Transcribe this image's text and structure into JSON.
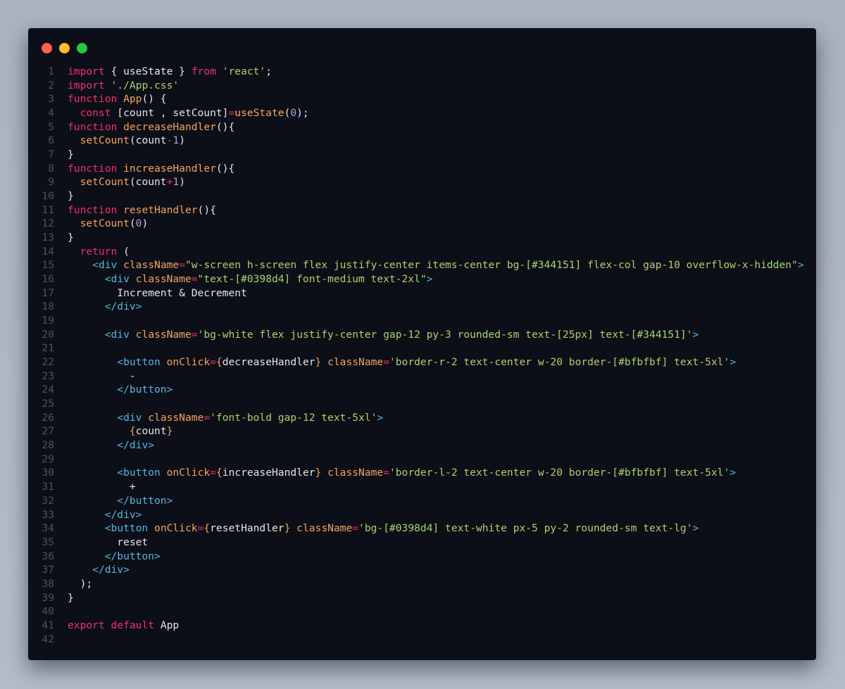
{
  "window": {
    "background": "#0c0f17",
    "traffic_lights": [
      {
        "name": "close",
        "color": "#ff5f57"
      },
      {
        "name": "minimize",
        "color": "#febc2e"
      },
      {
        "name": "maximize",
        "color": "#28c840"
      }
    ]
  },
  "colors": {
    "keyword": "#f0306c",
    "function": "#f5a35f",
    "string": "#a8d46f",
    "tag": "#56b6e0",
    "attr": "#f5a35f",
    "number": "#bd93f9",
    "plain": "#e6e6e6",
    "line_number": "#4b5263"
  },
  "code": {
    "lines": [
      {
        "n": "1",
        "tokens": [
          [
            "kw",
            "import"
          ],
          [
            "p",
            " { useState } "
          ],
          [
            "kw",
            "from"
          ],
          [
            "p",
            " "
          ],
          [
            "str",
            "'react'"
          ],
          [
            "p",
            ";"
          ]
        ]
      },
      {
        "n": "2",
        "tokens": [
          [
            "kw",
            "import"
          ],
          [
            "p",
            " "
          ],
          [
            "str",
            "'./App.css'"
          ]
        ]
      },
      {
        "n": "3",
        "tokens": [
          [
            "kw",
            "function"
          ],
          [
            "p",
            " "
          ],
          [
            "fn",
            "App"
          ],
          [
            "p",
            "() {"
          ]
        ]
      },
      {
        "n": "4",
        "tokens": [
          [
            "p",
            "  "
          ],
          [
            "kw",
            "const"
          ],
          [
            "p",
            " [count , setCount]"
          ],
          [
            "kw",
            "="
          ],
          [
            "fn",
            "useState"
          ],
          [
            "p",
            "("
          ],
          [
            "num",
            "0"
          ],
          [
            "p",
            ");"
          ]
        ]
      },
      {
        "n": "5",
        "tokens": [
          [
            "kw",
            "function"
          ],
          [
            "p",
            " "
          ],
          [
            "fn",
            "decreaseHandler"
          ],
          [
            "p",
            "(){"
          ]
        ]
      },
      {
        "n": "6",
        "tokens": [
          [
            "p",
            "  "
          ],
          [
            "fn",
            "setCount"
          ],
          [
            "p",
            "(count"
          ],
          [
            "kw",
            "-"
          ],
          [
            "num",
            "1"
          ],
          [
            "p",
            ")"
          ]
        ]
      },
      {
        "n": "7",
        "tokens": [
          [
            "p",
            "}"
          ]
        ]
      },
      {
        "n": "8",
        "tokens": [
          [
            "kw",
            "function"
          ],
          [
            "p",
            " "
          ],
          [
            "fn",
            "increaseHandler"
          ],
          [
            "p",
            "(){"
          ]
        ]
      },
      {
        "n": "9",
        "tokens": [
          [
            "p",
            "  "
          ],
          [
            "fn",
            "setCount"
          ],
          [
            "p",
            "(count"
          ],
          [
            "kw",
            "+"
          ],
          [
            "num",
            "1"
          ],
          [
            "p",
            ")"
          ]
        ]
      },
      {
        "n": "10",
        "tokens": [
          [
            "p",
            "}"
          ]
        ]
      },
      {
        "n": "11",
        "tokens": [
          [
            "kw",
            "function"
          ],
          [
            "p",
            " "
          ],
          [
            "fn",
            "resetHandler"
          ],
          [
            "p",
            "(){"
          ]
        ]
      },
      {
        "n": "12",
        "tokens": [
          [
            "p",
            "  "
          ],
          [
            "fn",
            "setCount"
          ],
          [
            "p",
            "("
          ],
          [
            "num",
            "0"
          ],
          [
            "p",
            ")"
          ]
        ]
      },
      {
        "n": "13",
        "tokens": [
          [
            "p",
            "}"
          ]
        ]
      },
      {
        "n": "14",
        "tokens": [
          [
            "p",
            "  "
          ],
          [
            "kw",
            "return"
          ],
          [
            "p",
            " ("
          ]
        ]
      },
      {
        "n": "15",
        "tokens": [
          [
            "p",
            "    "
          ],
          [
            "tag",
            "<div"
          ],
          [
            "p",
            " "
          ],
          [
            "attr",
            "className"
          ],
          [
            "kw",
            "="
          ],
          [
            "str",
            "\"w-screen h-screen flex justify-center items-center bg-[#344151] flex-col gap-10 overflow-x-hidden\""
          ],
          [
            "tag",
            ">"
          ]
        ]
      },
      {
        "n": "16",
        "tokens": [
          [
            "p",
            "      "
          ],
          [
            "tag",
            "<div"
          ],
          [
            "p",
            " "
          ],
          [
            "attr",
            "className"
          ],
          [
            "kw",
            "="
          ],
          [
            "str",
            "\"text-[#0398d4] font-medium text-2xl\""
          ],
          [
            "tag",
            ">"
          ]
        ]
      },
      {
        "n": "17",
        "tokens": [
          [
            "p",
            "        Increment & Decrement"
          ]
        ]
      },
      {
        "n": "18",
        "tokens": [
          [
            "p",
            "      "
          ],
          [
            "tag",
            "</div>"
          ]
        ]
      },
      {
        "n": "19",
        "tokens": []
      },
      {
        "n": "20",
        "tokens": [
          [
            "p",
            "      "
          ],
          [
            "tag",
            "<div"
          ],
          [
            "p",
            " "
          ],
          [
            "attr",
            "className"
          ],
          [
            "kw",
            "="
          ],
          [
            "str",
            "'bg-white flex justify-center gap-12 py-3 rounded-sm text-[25px] text-[#344151]'"
          ],
          [
            "tag",
            ">"
          ]
        ]
      },
      {
        "n": "21",
        "tokens": []
      },
      {
        "n": "22",
        "tokens": [
          [
            "p",
            "        "
          ],
          [
            "tag",
            "<button"
          ],
          [
            "p",
            " "
          ],
          [
            "attr",
            "onClick"
          ],
          [
            "kw",
            "="
          ],
          [
            "fn",
            "{"
          ],
          [
            "p",
            "decreaseHandler"
          ],
          [
            "fn",
            "}"
          ],
          [
            "p",
            " "
          ],
          [
            "attr",
            "className"
          ],
          [
            "kw",
            "="
          ],
          [
            "str",
            "'border-r-2 text-center w-20 border-[#bfbfbf] text-5xl'"
          ],
          [
            "tag",
            ">"
          ]
        ]
      },
      {
        "n": "23",
        "tokens": [
          [
            "p",
            "          -"
          ]
        ]
      },
      {
        "n": "24",
        "tokens": [
          [
            "p",
            "        "
          ],
          [
            "tag",
            "</button>"
          ]
        ]
      },
      {
        "n": "25",
        "tokens": []
      },
      {
        "n": "26",
        "tokens": [
          [
            "p",
            "        "
          ],
          [
            "tag",
            "<div"
          ],
          [
            "p",
            " "
          ],
          [
            "attr",
            "className"
          ],
          [
            "kw",
            "="
          ],
          [
            "str",
            "'font-bold gap-12 text-5xl'"
          ],
          [
            "tag",
            ">"
          ]
        ]
      },
      {
        "n": "27",
        "tokens": [
          [
            "p",
            "          "
          ],
          [
            "fn",
            "{"
          ],
          [
            "p",
            "count"
          ],
          [
            "fn",
            "}"
          ]
        ]
      },
      {
        "n": "28",
        "tokens": [
          [
            "p",
            "        "
          ],
          [
            "tag",
            "</div>"
          ]
        ]
      },
      {
        "n": "29",
        "tokens": []
      },
      {
        "n": "30",
        "tokens": [
          [
            "p",
            "        "
          ],
          [
            "tag",
            "<button"
          ],
          [
            "p",
            " "
          ],
          [
            "attr",
            "onClick"
          ],
          [
            "kw",
            "="
          ],
          [
            "fn",
            "{"
          ],
          [
            "p",
            "increaseHandler"
          ],
          [
            "fn",
            "}"
          ],
          [
            "p",
            " "
          ],
          [
            "attr",
            "className"
          ],
          [
            "kw",
            "="
          ],
          [
            "str",
            "'border-l-2 text-center w-20 border-[#bfbfbf] text-5xl'"
          ],
          [
            "tag",
            ">"
          ]
        ]
      },
      {
        "n": "31",
        "tokens": [
          [
            "p",
            "          +"
          ]
        ]
      },
      {
        "n": "32",
        "tokens": [
          [
            "p",
            "        "
          ],
          [
            "tag",
            "</button>"
          ]
        ]
      },
      {
        "n": "33",
        "tokens": [
          [
            "p",
            "      "
          ],
          [
            "tag",
            "</div>"
          ]
        ]
      },
      {
        "n": "34",
        "tokens": [
          [
            "p",
            "      "
          ],
          [
            "tag",
            "<button"
          ],
          [
            "p",
            " "
          ],
          [
            "attr",
            "onClick"
          ],
          [
            "kw",
            "="
          ],
          [
            "fn",
            "{"
          ],
          [
            "p",
            "resetHandler"
          ],
          [
            "fn",
            "}"
          ],
          [
            "p",
            " "
          ],
          [
            "attr",
            "className"
          ],
          [
            "kw",
            "="
          ],
          [
            "str",
            "'bg-[#0398d4] text-white px-5 py-2 rounded-sm text-lg'"
          ],
          [
            "tag",
            ">"
          ]
        ]
      },
      {
        "n": "35",
        "tokens": [
          [
            "p",
            "        reset"
          ]
        ]
      },
      {
        "n": "36",
        "tokens": [
          [
            "p",
            "      "
          ],
          [
            "tag",
            "</button>"
          ]
        ]
      },
      {
        "n": "37",
        "tokens": [
          [
            "p",
            "    "
          ],
          [
            "tag",
            "</div>"
          ]
        ]
      },
      {
        "n": "38",
        "tokens": [
          [
            "p",
            "  );"
          ]
        ]
      },
      {
        "n": "39",
        "tokens": [
          [
            "p",
            "}"
          ]
        ]
      },
      {
        "n": "40",
        "tokens": []
      },
      {
        "n": "41",
        "tokens": [
          [
            "kw",
            "export"
          ],
          [
            "p",
            " "
          ],
          [
            "kw",
            "default"
          ],
          [
            "p",
            " App"
          ]
        ]
      },
      {
        "n": "42",
        "tokens": []
      }
    ]
  }
}
